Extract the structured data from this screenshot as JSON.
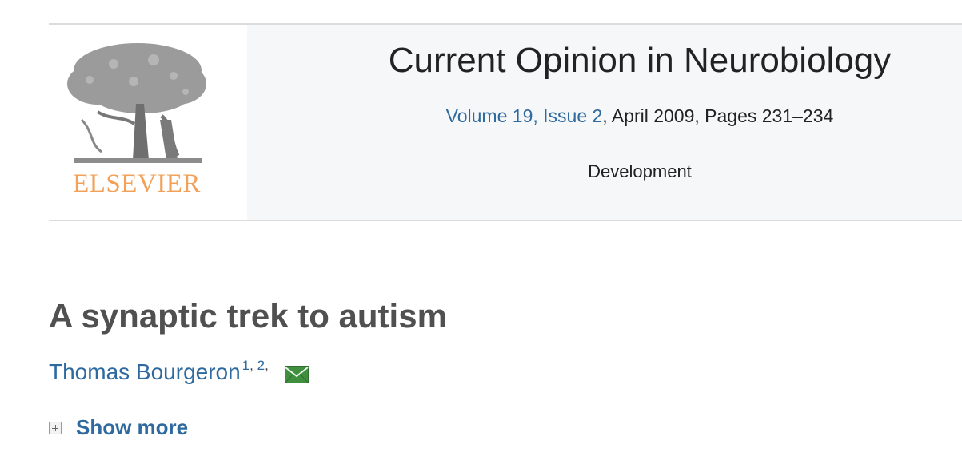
{
  "header": {
    "publisher_logo_text": "ELSEVIER",
    "journal_title": "Current Opinion in Neurobiology",
    "volume_link": "Volume 19, Issue 2",
    "issue_details": ", April 2009, Pages 231–234",
    "section": "Development"
  },
  "article": {
    "title": "A synaptic trek to autism",
    "author": {
      "name": "Thomas Bourgeron",
      "affiliations": [
        "1",
        "2"
      ]
    },
    "email_icon": "envelope-icon",
    "show_more_label": "Show more",
    "show_more_icon": "plus-square-icon"
  },
  "colors": {
    "link": "#2e6a9f",
    "logo_orange": "#f2a15a",
    "title_gray": "#505050",
    "header_band": "#f6f7f8"
  }
}
